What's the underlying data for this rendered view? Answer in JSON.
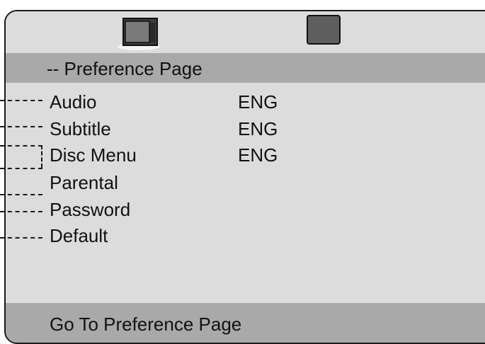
{
  "header": {
    "title": "-- Preference Page"
  },
  "icons": {
    "tv": "tv-icon",
    "square": "square-icon"
  },
  "menu": {
    "items": [
      {
        "label": "Audio",
        "value": "ENG"
      },
      {
        "label": "Subtitle",
        "value": "ENG"
      },
      {
        "label": "Disc Menu",
        "value": "ENG"
      },
      {
        "label": "Parental",
        "value": ""
      },
      {
        "label": "Password",
        "value": ""
      },
      {
        "label": "Default",
        "value": ""
      }
    ]
  },
  "footer": {
    "text": "Go To Preference Page"
  },
  "colors": {
    "panel": "#dcdcdc",
    "bar": "#a9a9a9",
    "border": "#1a1a1a"
  }
}
